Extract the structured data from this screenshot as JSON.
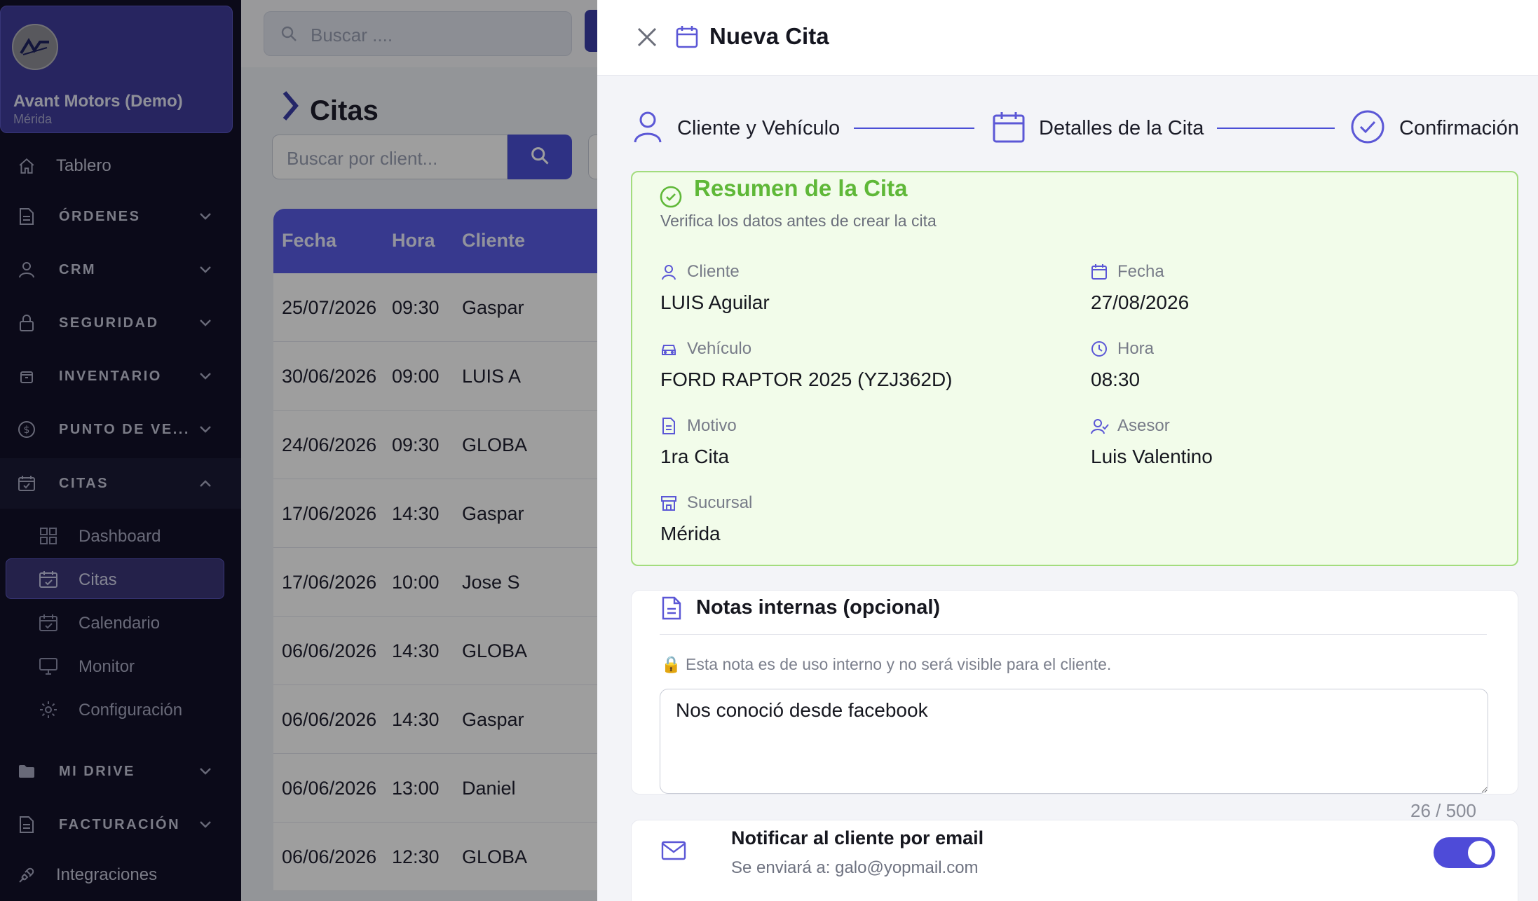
{
  "company": {
    "name": "Avant Motors (Demo)",
    "branch": "Mérida"
  },
  "sidebar": {
    "top_item": {
      "label": "Tablero",
      "icon": "home-icon"
    },
    "sections": [
      {
        "label": "ÓRDENES",
        "icon": "file-icon"
      },
      {
        "label": "CRM",
        "icon": "user-icon"
      },
      {
        "label": "SEGURIDAD",
        "icon": "lock-icon"
      },
      {
        "label": "INVENTARIO",
        "icon": "box-icon"
      },
      {
        "label": "PUNTO DE VE...",
        "icon": "dollar-icon"
      },
      {
        "label": "CITAS",
        "icon": "calendar-check-icon",
        "expanded": true
      }
    ],
    "citas_items": [
      {
        "label": "Dashboard",
        "icon": "grid-icon"
      },
      {
        "label": "Citas",
        "icon": "calendar-check-icon",
        "active": true
      },
      {
        "label": "Calendario",
        "icon": "calendar-icon"
      },
      {
        "label": "Monitor",
        "icon": "monitor-icon"
      },
      {
        "label": "Configuración",
        "icon": "gear-icon"
      }
    ],
    "bottom_sections": [
      {
        "label": "MI DRIVE",
        "icon": "folder-icon"
      },
      {
        "label": "FACTURACIÓN",
        "icon": "file-icon"
      }
    ],
    "bottom_item": {
      "label": "Integraciones",
      "icon": "plug-icon"
    }
  },
  "main": {
    "search_placeholder": "Buscar ....",
    "page_title": "Citas",
    "filter_placeholder": "Buscar por client...",
    "table": {
      "columns": [
        "Fecha",
        "Hora",
        "Cliente"
      ],
      "rows": [
        {
          "fecha": "25/07/2026",
          "hora": "09:30",
          "cliente": "Gaspar"
        },
        {
          "fecha": "30/06/2026",
          "hora": "09:00",
          "cliente": "LUIS A"
        },
        {
          "fecha": "24/06/2026",
          "hora": "09:30",
          "cliente": "GLOBA"
        },
        {
          "fecha": "17/06/2026",
          "hora": "14:30",
          "cliente": "Gaspar"
        },
        {
          "fecha": "17/06/2026",
          "hora": "10:00",
          "cliente": "Jose S"
        },
        {
          "fecha": "06/06/2026",
          "hora": "14:30",
          "cliente": "GLOBA"
        },
        {
          "fecha": "06/06/2026",
          "hora": "14:30",
          "cliente": "Gaspar"
        },
        {
          "fecha": "06/06/2026",
          "hora": "13:00",
          "cliente": "Daniel"
        },
        {
          "fecha": "06/06/2026",
          "hora": "12:30",
          "cliente": "GLOBA"
        }
      ]
    }
  },
  "drawer": {
    "title": "Nueva Cita",
    "steps": [
      {
        "label": "Cliente y Vehículo",
        "icon": "user-icon"
      },
      {
        "label": "Detalles de la Cita",
        "icon": "calendar-icon"
      },
      {
        "label": "Confirmación",
        "icon": "check-circle-icon"
      }
    ],
    "summary": {
      "title": "Resumen de la Cita",
      "subtitle": "Verifica los datos antes de crear la cita",
      "fields": {
        "cliente": {
          "label": "Cliente",
          "value": "LUIS Aguilar"
        },
        "fecha": {
          "label": "Fecha",
          "value": "27/08/2026"
        },
        "vehiculo": {
          "label": "Vehículo",
          "value": "FORD RAPTOR 2025 (YZJ362D)"
        },
        "hora": {
          "label": "Hora",
          "value": "08:30"
        },
        "motivo": {
          "label": "Motivo",
          "value": "1ra Cita"
        },
        "asesor": {
          "label": "Asesor",
          "value": "Luis Valentino"
        },
        "sucursal": {
          "label": "Sucursal",
          "value": "Mérida"
        }
      }
    },
    "notes": {
      "title": "Notas internas (opcional)",
      "hint": "🔒 Esta nota es de uso interno y no será visible para el cliente.",
      "value": "Nos conoció desde facebook",
      "counter": "26 / 500"
    },
    "notify": {
      "title": "Notificar al cliente por email",
      "subtitle": "Se enviará a: galo@yopmail.com",
      "enabled": true
    }
  },
  "colors": {
    "accent": "#4b4fd6",
    "success": "#5fb838",
    "sidebar": "#121129"
  }
}
